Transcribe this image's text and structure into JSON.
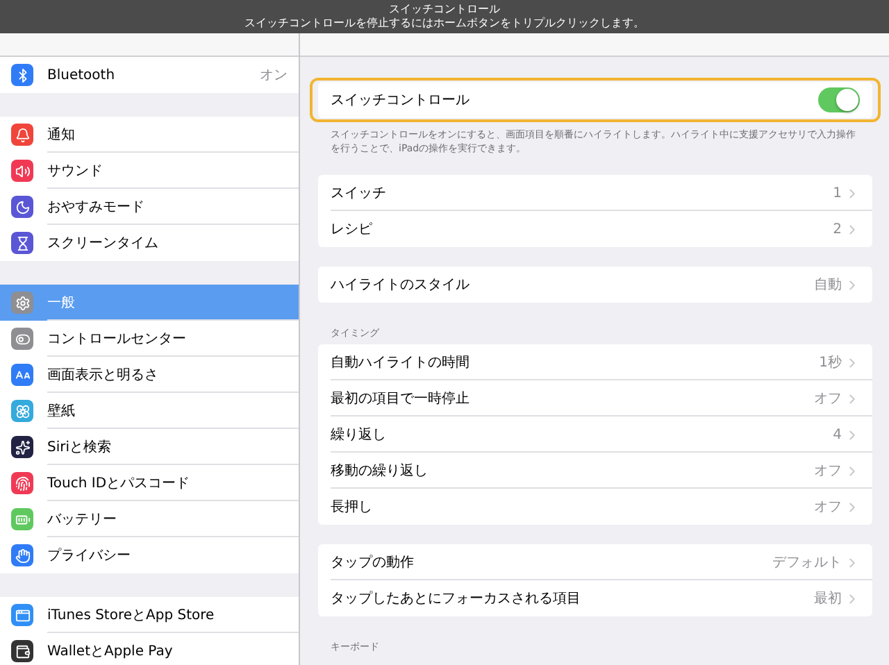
{
  "banner": {
    "title": "スイッチコントロール",
    "message": "スイッチコントロールを停止するにはホームボタンをトリプルクリックします。"
  },
  "sidebar": {
    "groups": [
      [
        {
          "label": "Bluetooth",
          "value": "オン",
          "selected": false
        }
      ],
      [
        {
          "label": "通知",
          "selected": false
        },
        {
          "label": "サウンド",
          "selected": false
        },
        {
          "label": "おやすみモード",
          "selected": false
        },
        {
          "label": "スクリーンタイム",
          "selected": false
        }
      ],
      [
        {
          "label": "一般",
          "selected": true
        },
        {
          "label": "コントロールセンター",
          "selected": false
        },
        {
          "label": "画面表示と明るさ",
          "selected": false
        },
        {
          "label": "壁紙",
          "selected": false
        },
        {
          "label": "Siriと検索",
          "selected": false
        },
        {
          "label": "Touch IDとパスコード",
          "selected": false
        },
        {
          "label": "バッテリー",
          "selected": false
        },
        {
          "label": "プライバシー",
          "selected": false
        }
      ],
      [
        {
          "label": "iTunes StoreとApp Store",
          "selected": false
        },
        {
          "label": "WalletとApple Pay",
          "selected": false
        }
      ]
    ]
  },
  "switch_control": {
    "label": "スイッチコントロール",
    "on": true,
    "focused": true,
    "description": "スイッチコントロールをオンにすると、画面項目を順番にハイライトします。ハイライト中に支援アクセサリで入力操作を行うことで、iPadの操作を実行できます。"
  },
  "groups": [
    {
      "rows": [
        {
          "label": "スイッチ",
          "value": "1"
        },
        {
          "label": "レシピ",
          "value": "2"
        }
      ]
    },
    {
      "rows": [
        {
          "label": "ハイライトのスタイル",
          "value": "自動"
        }
      ]
    },
    {
      "header": "タイミング",
      "rows": [
        {
          "label": "自動ハイライトの時間",
          "value": "1秒"
        },
        {
          "label": "最初の項目で一時停止",
          "value": "オフ"
        },
        {
          "label": "繰り返し",
          "value": "4"
        },
        {
          "label": "移動の繰り返し",
          "value": "オフ"
        },
        {
          "label": "長押し",
          "value": "オフ"
        }
      ]
    },
    {
      "rows": [
        {
          "label": "タップの動作",
          "value": "デフォルト"
        },
        {
          "label": "タップしたあとにフォーカスされる項目",
          "value": "最初"
        }
      ]
    },
    {
      "header": "キーボード"
    }
  ]
}
